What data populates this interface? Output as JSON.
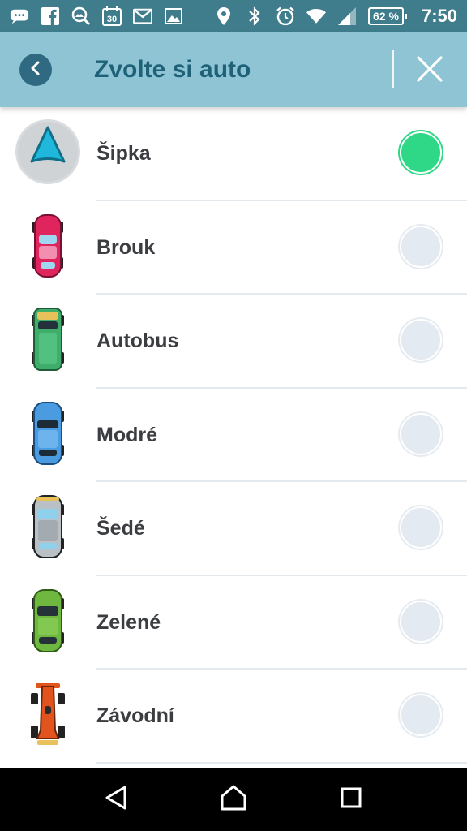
{
  "status_bar": {
    "left_icons": [
      "messages-icon",
      "facebook-icon",
      "gallery-search-icon",
      "calendar-icon",
      "gmail-icon",
      "image-icon"
    ],
    "calendar_day": "30",
    "right_icons": [
      "location-icon",
      "bluetooth-icon",
      "alarm-icon",
      "wifi-icon",
      "signal-icon"
    ],
    "battery": "62 %",
    "time": "7:50"
  },
  "header": {
    "title": "Zvolte si auto",
    "back_icon": "chevron-left-icon",
    "close_icon": "close-icon"
  },
  "cars": [
    {
      "label": "Šipka",
      "icon": "arrow-icon",
      "selected": true
    },
    {
      "label": "Brouk",
      "icon": "pink-convertible-icon",
      "selected": false
    },
    {
      "label": "Autobus",
      "icon": "green-van-icon",
      "selected": false
    },
    {
      "label": "Modré",
      "icon": "blue-car-icon",
      "selected": false
    },
    {
      "label": "Šedé",
      "icon": "gray-car-icon",
      "selected": false
    },
    {
      "label": "Zelené",
      "icon": "green-car-icon",
      "selected": false
    },
    {
      "label": "Závodní",
      "icon": "race-car-icon",
      "selected": false
    }
  ],
  "colors": {
    "status_bar": "#3f7d8d",
    "header_bg": "#8ec4d4",
    "header_title": "#1f6178",
    "radio_selected": "#2ed887",
    "radio_unselected": "#e3eaf1"
  },
  "nav": {
    "back_icon": "nav-back-icon",
    "home_icon": "nav-home-icon",
    "recents_icon": "nav-recents-icon"
  }
}
